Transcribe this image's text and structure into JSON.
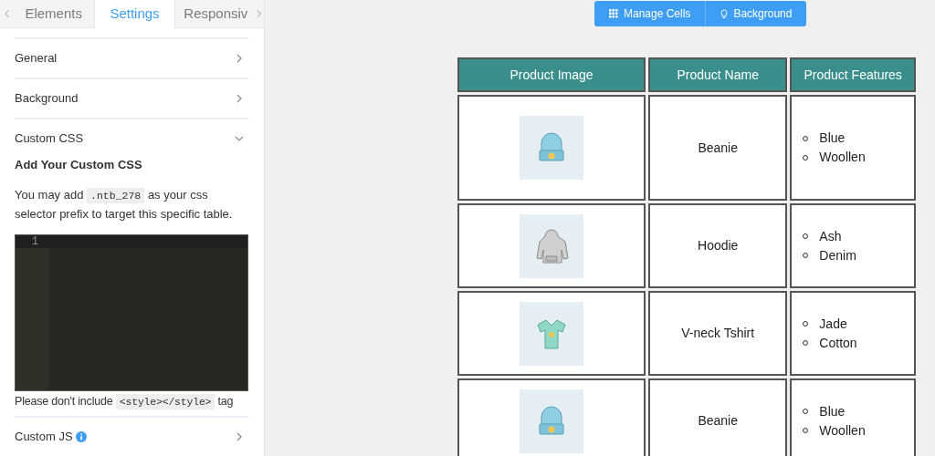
{
  "tabs": [
    {
      "label": "Elements",
      "selected": false
    },
    {
      "label": "Settings",
      "selected": true
    },
    {
      "label": "Responsiv",
      "selected": false
    }
  ],
  "sections": [
    {
      "title": "General",
      "expanded": false
    },
    {
      "title": "Background",
      "expanded": false
    },
    {
      "title": "Custom CSS",
      "expanded": true,
      "content": {
        "heading": "Add Your Custom CSS",
        "description": [
          {
            "kind": "text",
            "text": "You may add"
          },
          {
            "kind": "code",
            "text": ".ntb_278"
          },
          {
            "kind": "text",
            "text": "as your css selector prefix to target this specific table."
          }
        ],
        "line_numbers": [
          "1"
        ],
        "note": [
          {
            "kind": "text",
            "text": "Please don't include"
          },
          {
            "kind": "code",
            "text": "<style></style>"
          },
          {
            "kind": "text",
            "text": "tag"
          }
        ]
      }
    },
    {
      "title": "Custom JS",
      "expanded": false,
      "info": true
    }
  ],
  "toolbar": [
    {
      "kind": "grid",
      "label": "Manage Cells"
    },
    {
      "kind": "bulb",
      "label": "Background"
    }
  ],
  "table": {
    "columns": [
      "Product Image",
      "Product Name",
      "Product Features"
    ],
    "rows": [
      {
        "kind": "beanie",
        "name": "Beanie",
        "features": [
          "Blue",
          "Woollen"
        ]
      },
      {
        "kind": "hoodie",
        "name": "Hoodie",
        "features": [
          "Ash",
          "Denim"
        ]
      },
      {
        "kind": "tshirt",
        "name": "V-neck Tshirt",
        "features": [
          "Jade",
          "Cotton"
        ]
      },
      {
        "kind": "beanie",
        "name": "Beanie",
        "features": [
          "Blue",
          "Woollen"
        ]
      }
    ]
  }
}
